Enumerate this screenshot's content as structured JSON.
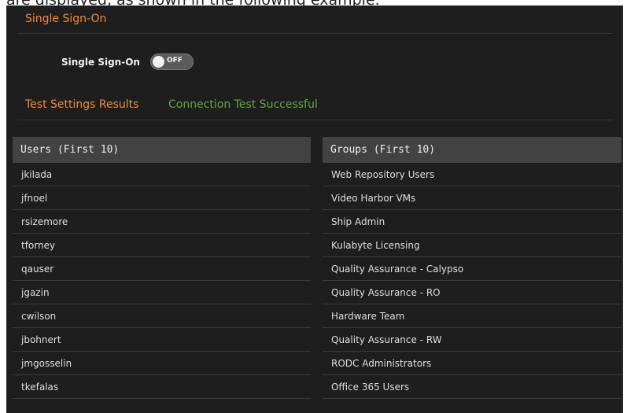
{
  "doc_caption": "are displayed, as shown in the following example.",
  "sso_section": {
    "title": "Single Sign-On",
    "toggle_label": "Single Sign-On",
    "toggle_state": "OFF"
  },
  "test_section": {
    "title": "Test Settings Results",
    "status": "Connection Test Successful",
    "status_color": "#62a545"
  },
  "users": {
    "header": "Users (First 10)",
    "items": [
      "jkilada",
      "jfnoel",
      "rsizemore",
      "tforney",
      "qauser",
      "jgazin",
      "cwilson",
      "jbohnert",
      "jmgosselin",
      "tkefalas"
    ]
  },
  "groups": {
    "header": "Groups (First 10)",
    "items": [
      "Web Repository Users",
      "Video Harbor VMs",
      "Ship Admin",
      "Kulabyte Licensing",
      "Quality Assurance - Calypso",
      "Quality Assurance - RO",
      "Hardware Team",
      "Quality Assurance - RW",
      "RODC Administrators",
      "Office 365 Users"
    ]
  },
  "colors": {
    "accent": "#ee8a3c",
    "panel_bg": "#1e1e1e",
    "header_bg": "#424242"
  }
}
